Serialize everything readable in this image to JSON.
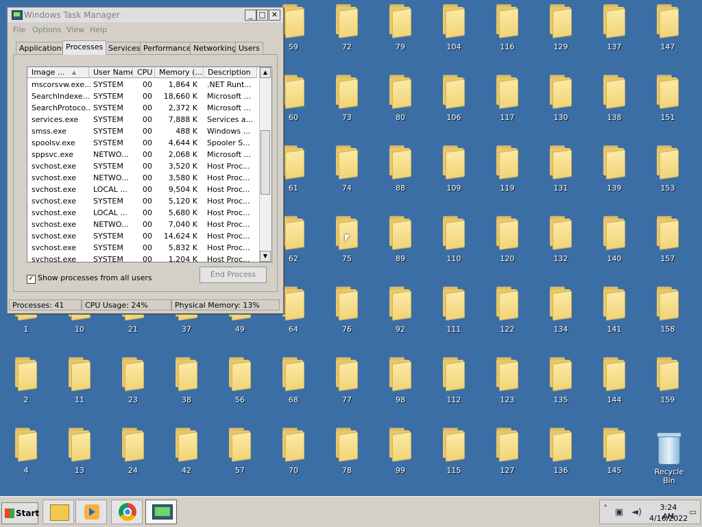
{
  "desktop": {
    "icons": [
      {
        "label": "59"
      },
      {
        "label": "72"
      },
      {
        "label": "79"
      },
      {
        "label": "104"
      },
      {
        "label": "116"
      },
      {
        "label": "129"
      },
      {
        "label": "137"
      },
      {
        "label": "147"
      },
      {
        "label": "60"
      },
      {
        "label": "73"
      },
      {
        "label": "80"
      },
      {
        "label": "106"
      },
      {
        "label": "117"
      },
      {
        "label": "130"
      },
      {
        "label": "138"
      },
      {
        "label": "151"
      },
      {
        "label": "61"
      },
      {
        "label": "74"
      },
      {
        "label": "88"
      },
      {
        "label": "109"
      },
      {
        "label": "119"
      },
      {
        "label": "131"
      },
      {
        "label": "139"
      },
      {
        "label": "153"
      },
      {
        "label": "62"
      },
      {
        "label": "75"
      },
      {
        "label": "89"
      },
      {
        "label": "110"
      },
      {
        "label": "120"
      },
      {
        "label": "132"
      },
      {
        "label": "140"
      },
      {
        "label": "157"
      },
      {
        "label": "1"
      },
      {
        "label": "10"
      },
      {
        "label": "21"
      },
      {
        "label": "37"
      },
      {
        "label": "49"
      },
      {
        "label": "64"
      },
      {
        "label": "76"
      },
      {
        "label": "92"
      },
      {
        "label": "111"
      },
      {
        "label": "122"
      },
      {
        "label": "134"
      },
      {
        "label": "141"
      },
      {
        "label": "158"
      },
      {
        "label": "2"
      },
      {
        "label": "11"
      },
      {
        "label": "23"
      },
      {
        "label": "38"
      },
      {
        "label": "56"
      },
      {
        "label": "68"
      },
      {
        "label": "77"
      },
      {
        "label": "98"
      },
      {
        "label": "112"
      },
      {
        "label": "123"
      },
      {
        "label": "135"
      },
      {
        "label": "144"
      },
      {
        "label": "159"
      },
      {
        "label": "4"
      },
      {
        "label": "13"
      },
      {
        "label": "24"
      },
      {
        "label": "42"
      },
      {
        "label": "57"
      },
      {
        "label": "70"
      },
      {
        "label": "78"
      },
      {
        "label": "99"
      },
      {
        "label": "115"
      },
      {
        "label": "127"
      },
      {
        "label": "136"
      },
      {
        "label": "145"
      }
    ],
    "recycle_bin": "Recycle Bin"
  },
  "window": {
    "title": "Windows Task Manager",
    "menu": [
      "File",
      "Options",
      "View",
      "Help"
    ],
    "tabs": [
      "Applications",
      "Processes",
      "Services",
      "Performance",
      "Networking",
      "Users"
    ],
    "active_tab": "Processes",
    "columns": [
      "Image ...",
      "User Name",
      "CPU",
      "Memory (...",
      "Description"
    ],
    "rows": [
      [
        "mscorsvw.exe...",
        "SYSTEM",
        "00",
        "1,864 K",
        ".NET Runt..."
      ],
      [
        "SearchIndexe...",
        "SYSTEM",
        "00",
        "18,660 K",
        "Microsoft ..."
      ],
      [
        "SearchProtoco...",
        "SYSTEM",
        "00",
        "2,372 K",
        "Microsoft ..."
      ],
      [
        "services.exe",
        "SYSTEM",
        "00",
        "7,888 K",
        "Services a..."
      ],
      [
        "smss.exe",
        "SYSTEM",
        "00",
        "488 K",
        "Windows ..."
      ],
      [
        "spoolsv.exe",
        "SYSTEM",
        "00",
        "4,644 K",
        "Spooler S..."
      ],
      [
        "sppsvc.exe",
        "NETWO...",
        "00",
        "2,068 K",
        "Microsoft ..."
      ],
      [
        "svchost.exe",
        "SYSTEM",
        "00",
        "3,520 K",
        "Host Proc..."
      ],
      [
        "svchost.exe",
        "NETWO...",
        "00",
        "3,580 K",
        "Host Proc..."
      ],
      [
        "svchost.exe",
        "LOCAL ...",
        "00",
        "9,504 K",
        "Host Proc..."
      ],
      [
        "svchost.exe",
        "SYSTEM",
        "00",
        "5,120 K",
        "Host Proc..."
      ],
      [
        "svchost.exe",
        "LOCAL ...",
        "00",
        "5,680 K",
        "Host Proc..."
      ],
      [
        "svchost.exe",
        "NETWO...",
        "00",
        "7,040 K",
        "Host Proc..."
      ],
      [
        "svchost.exe",
        "SYSTEM",
        "00",
        "14,624 K",
        "Host Proc..."
      ],
      [
        "svchost.exe",
        "SYSTEM",
        "00",
        "5,832 K",
        "Host Proc..."
      ],
      [
        "svchost.exe",
        "SYSTEM",
        "00",
        "1,204 K",
        "Host Proc..."
      ]
    ],
    "show_all_label": "Show processes from all users",
    "show_all_checked": "✓",
    "end_process_label": "End Process",
    "status": {
      "processes": "Processes: 41",
      "cpu": "CPU Usage: 24%",
      "memory": "Physical Memory: 13%"
    },
    "buttons": {
      "minimize": "_",
      "maximize": "□",
      "close": "✕"
    }
  },
  "taskbar": {
    "start_label": "Start",
    "apps": [
      "explorer-icon",
      "media-player-icon",
      "chrome-icon",
      "task-manager-icon"
    ],
    "tray": {
      "time": "3:24 AM",
      "date": "4/16/2022",
      "chevron": "˄"
    }
  }
}
